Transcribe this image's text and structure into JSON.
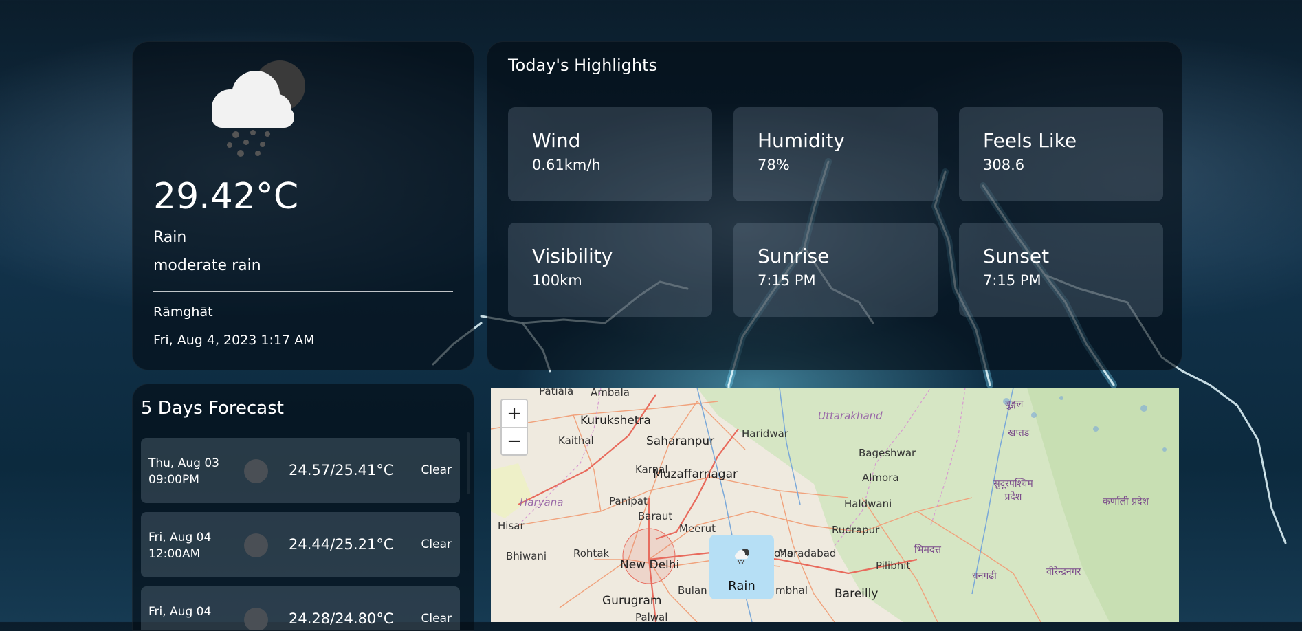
{
  "current": {
    "icon": "rain-cloud-night-icon",
    "temperature": "29.42°C",
    "condition": "Rain",
    "description": "moderate rain",
    "location": "Rāmghāt",
    "datetime": "Fri, Aug 4, 2023 1:17 AM"
  },
  "highlights": {
    "title": "Today's Highlights",
    "cards": [
      {
        "label": "Wind",
        "value": "0.61km/h"
      },
      {
        "label": "Humidity",
        "value": "78%"
      },
      {
        "label": "Feels Like",
        "value": "308.6"
      },
      {
        "label": "Visibility",
        "value": "100km"
      },
      {
        "label": "Sunrise",
        "value": "7:15 PM"
      },
      {
        "label": "Sunset",
        "value": "7:15 PM"
      }
    ]
  },
  "forecast": {
    "title": "5 Days Forecast",
    "rows": [
      {
        "date": "Thu, Aug 03",
        "time": "09:00PM",
        "temp": "24.57/25.41°C",
        "condition": "Clear"
      },
      {
        "date": "Fri, Aug 04",
        "time": "12:00AM",
        "temp": "24.44/25.21°C",
        "condition": "Clear"
      },
      {
        "date": "Fri, Aug 04",
        "time": "",
        "temp": "24.28/24.80°C",
        "condition": "Clear"
      }
    ]
  },
  "map": {
    "zoom_in": "+",
    "zoom_out": "−",
    "marker_label": "Rain",
    "labels": [
      "Patiala",
      "Ambala",
      "Kurukshetra",
      "Kaithal",
      "Saharanpur",
      "Haridwar",
      "Uttarakhand",
      "Bageshwar",
      "Almora",
      "Karnal",
      "Muzaffarnagar",
      "Haryana",
      "Panipat",
      "Baraut",
      "Haldwani",
      "Hisar",
      "Meerut",
      "Rudrapur",
      "Bhiwani",
      "Rohtak",
      "New Delhi",
      "Moradabad",
      "Pilibhit",
      "Gurugram",
      "Bareilly",
      "Palwal",
      "Bulan",
      "mbhal",
      "oha",
      "सुदूरपश्चिम प्रदेश",
      "कर्णाली प्रदेश",
      "भिमदत्त",
      "धनगढी",
      "वीरेन्द्रनगर",
      "बुङ्गल",
      "खप्तड"
    ]
  }
}
